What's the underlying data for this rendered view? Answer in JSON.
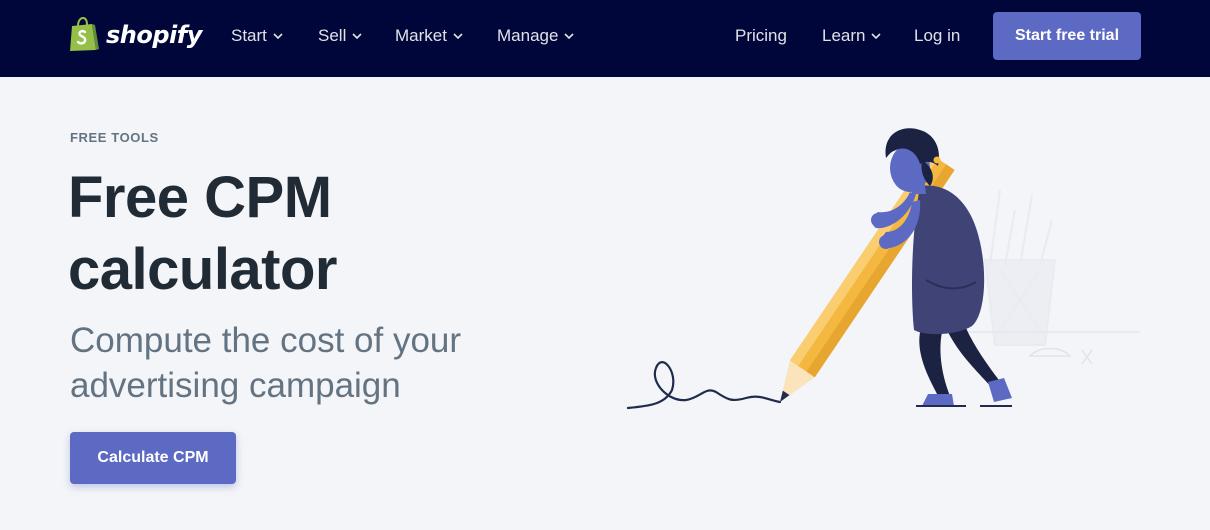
{
  "brand": {
    "name": "shopify"
  },
  "nav": {
    "items": [
      {
        "label": "Start",
        "icon": "chevron-down-icon"
      },
      {
        "label": "Sell",
        "icon": "chevron-down-icon"
      },
      {
        "label": "Market",
        "icon": "chevron-down-icon"
      },
      {
        "label": "Manage",
        "icon": "chevron-down-icon"
      }
    ],
    "pricing": "Pricing",
    "learn": "Learn",
    "login": "Log in",
    "cta": "Start free trial"
  },
  "hero": {
    "eyebrow": "FREE TOOLS",
    "title": "Free CPM calculator",
    "subtitle": "Compute the cost of your advertising campaign",
    "button": "Calculate CPM"
  },
  "colors": {
    "nav_bg": "#000639",
    "accent": "#5c6ac4",
    "page_bg": "#f4f5f8",
    "heading": "#212b36",
    "muted": "#637381",
    "pencil": "#f4b740"
  }
}
